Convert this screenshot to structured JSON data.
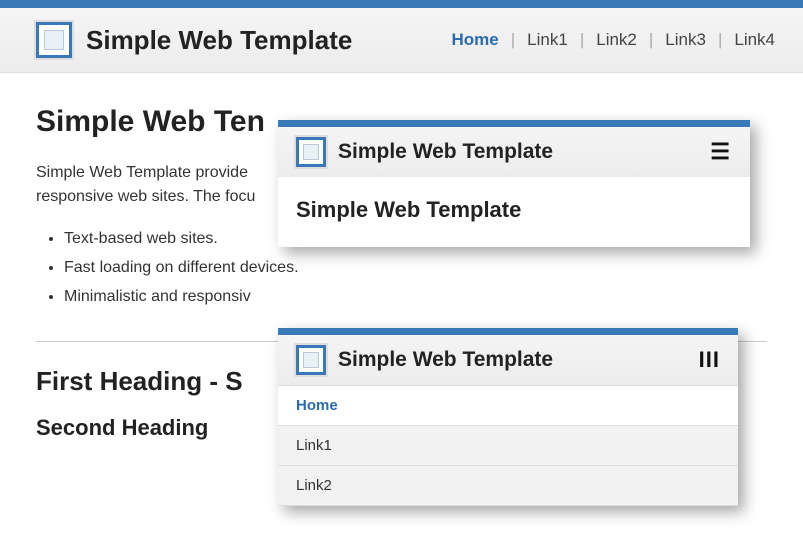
{
  "header": {
    "site_title": "Simple Web Template",
    "nav": [
      {
        "label": "Home",
        "active": true
      },
      {
        "label": "Link1",
        "active": false
      },
      {
        "label": "Link2",
        "active": false
      },
      {
        "label": "Link3",
        "active": false
      },
      {
        "label": "Link4",
        "active": false
      }
    ]
  },
  "main": {
    "h1_partial": "Simple Web Ten",
    "para_line1": "Simple Web Template provide",
    "para_line2": "responsive web sites. The focu",
    "bullets": [
      "Text-based web sites.",
      "Fast loading on different devices.",
      "Minimalistic and responsiv"
    ],
    "h2_partial": "First Heading - S",
    "h3": "Second Heading"
  },
  "card1": {
    "title": "Simple Web Template",
    "body_heading": "Simple Web Template",
    "hamburger_glyph": "☰"
  },
  "card2": {
    "title": "Simple Web Template",
    "triple_glyph": "III",
    "menu": [
      {
        "label": "Home",
        "active": true
      },
      {
        "label": "Link1",
        "active": false
      },
      {
        "label": "Link2",
        "active": false
      }
    ]
  }
}
